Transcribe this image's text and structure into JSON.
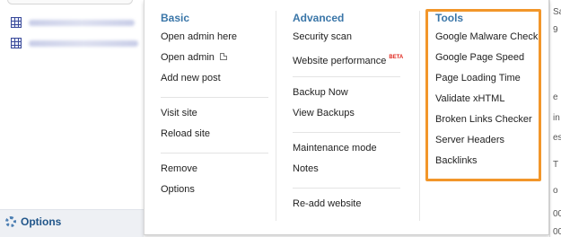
{
  "sidebar": {
    "sites": [
      {
        "label": "seasongardenbehind.com"
      },
      {
        "label": "northhousebehindsite.com"
      }
    ],
    "options_label": "Options"
  },
  "menu": {
    "basic": {
      "heading": "Basic",
      "groups": [
        [
          "Open admin here",
          "Open admin",
          "Add new post"
        ],
        [
          "Visit site",
          "Reload site"
        ],
        [
          "Remove",
          "Options"
        ]
      ]
    },
    "advanced": {
      "heading": "Advanced",
      "groups": [
        [
          "Security scan",
          "Website performance"
        ],
        [
          "Backup Now",
          "View Backups"
        ],
        [
          "Maintenance mode",
          "Notes"
        ],
        [
          "Re-add website"
        ]
      ],
      "beta_badge": "BETA"
    },
    "tools": {
      "heading": "Tools",
      "items": [
        "Google Malware Check",
        "Google Page Speed",
        "Page Loading Time",
        "Validate xHTML",
        "Broken Links Checker",
        "Server Headers",
        "Backlinks"
      ],
      "highlight_color": "#f2962a"
    }
  },
  "right_edge_fragments": [
    "Sa",
    "9",
    "e",
    "in",
    "es",
    "T",
    "o",
    "00",
    "00"
  ],
  "colors": {
    "heading": "#3a76a8",
    "link": "#21568a",
    "beta": "#e0261d"
  }
}
